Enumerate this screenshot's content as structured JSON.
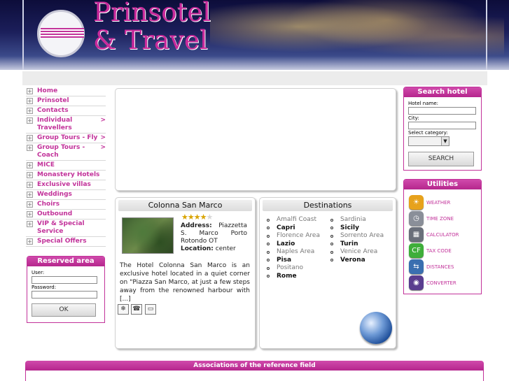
{
  "header": {
    "brand_line1": "Prinsotel",
    "brand_line2": "& Travel"
  },
  "nav": {
    "items": [
      {
        "label": "Home",
        "arrow": ""
      },
      {
        "label": "Prinsotel",
        "arrow": ""
      },
      {
        "label": "Contacts",
        "arrow": ""
      },
      {
        "label": "Individual Travellers",
        "arrow": ">"
      },
      {
        "label": "Group Tours - Fly",
        "arrow": ">"
      },
      {
        "label": "Group Tours - Coach",
        "arrow": ">"
      },
      {
        "label": "MICE",
        "arrow": ""
      },
      {
        "label": "Monastery Hotels",
        "arrow": ""
      },
      {
        "label": "Exclusive villas",
        "arrow": ""
      },
      {
        "label": "Weddings",
        "arrow": ""
      },
      {
        "label": "Choirs",
        "arrow": ""
      },
      {
        "label": "Outbound",
        "arrow": ""
      },
      {
        "label": "VIP & Special Service",
        "arrow": ""
      },
      {
        "label": "Special Offers",
        "arrow": ""
      }
    ]
  },
  "reserved": {
    "title": "Reserved area",
    "user_label": "User:",
    "password_label": "Password:",
    "ok_label": "OK"
  },
  "hotel": {
    "title": "Colonna San Marco",
    "stars_filled": 4,
    "stars_total": 5,
    "address_label": "Address:",
    "address_value": "Piazzetta S. Marco Porto Rotondo OT",
    "location_label": "Location:",
    "location_value": "center",
    "description": "The Hotel Colonna San Marco is an exclusive hotel located in a quiet corner on \"Piazza San Marco, at just a few steps away from the renowned harbour with [...]"
  },
  "destinations": {
    "title": "Destinations",
    "col1": [
      {
        "name": "Amalfi Coast",
        "style": "light"
      },
      {
        "name": "Capri",
        "style": "bold"
      },
      {
        "name": "Florence Area",
        "style": "light"
      },
      {
        "name": "Lazio",
        "style": "bold"
      },
      {
        "name": "Naples Area",
        "style": "light"
      },
      {
        "name": "Pisa",
        "style": "bold"
      },
      {
        "name": "Positano",
        "style": "light"
      },
      {
        "name": "Rome",
        "style": "bold"
      }
    ],
    "col2": [
      {
        "name": "Sardinia",
        "style": "light"
      },
      {
        "name": "Sicily",
        "style": "bold"
      },
      {
        "name": "Sorrento Area",
        "style": "light"
      },
      {
        "name": "Turin",
        "style": "bold"
      },
      {
        "name": "Venice Area",
        "style": "light"
      },
      {
        "name": "Verona",
        "style": "bold"
      }
    ]
  },
  "search": {
    "title": "Search hotel",
    "name_label": "Hotel name:",
    "city_label": "City:",
    "category_label": "Select category:",
    "button_label": "SEARCH"
  },
  "utilities": {
    "title": "Utilities",
    "items": [
      {
        "label": "WEATHER",
        "icon": "weather-icon",
        "color": "#e7a21c"
      },
      {
        "label": "TIME ZONE",
        "icon": "clock-icon",
        "color": "#8a8f99"
      },
      {
        "label": "CALCULATOR",
        "icon": "calculator-icon",
        "color": "#6a6f7a"
      },
      {
        "label": "TAX CODE",
        "icon": "tax-code-icon",
        "color": "#3fae3a"
      },
      {
        "label": "DISTANCES",
        "icon": "distances-icon",
        "color": "#3a6fb0"
      },
      {
        "label": "CONVERTER",
        "icon": "converter-icon",
        "color": "#5a3d8f"
      }
    ]
  },
  "footer": {
    "title": "Associations of the reference field"
  },
  "colors": {
    "accent": "#c2329a",
    "header_dark": "#1b1e5a"
  }
}
